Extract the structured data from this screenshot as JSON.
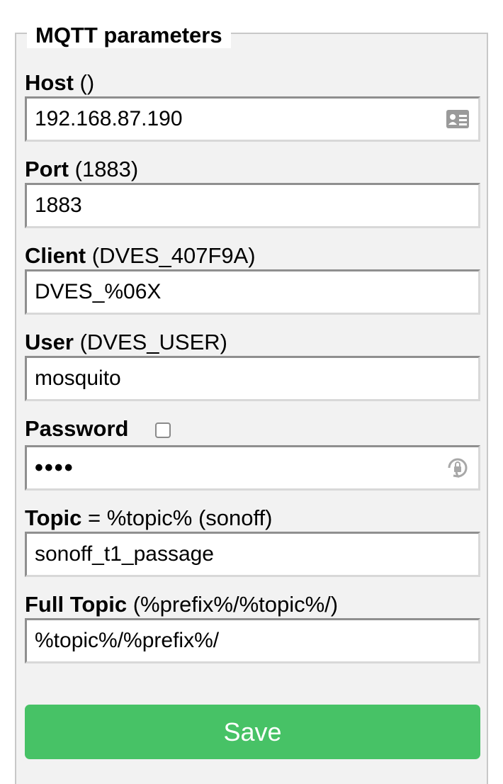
{
  "legend": "MQTT parameters",
  "fields": {
    "host": {
      "label": "Host",
      "hint": "()",
      "value": "192.168.87.190"
    },
    "port": {
      "label": "Port",
      "hint": "(1883)",
      "value": "1883"
    },
    "client": {
      "label": "Client",
      "hint": "(DVES_407F9A)",
      "value": "DVES_%06X"
    },
    "user": {
      "label": "User",
      "hint": "(DVES_USER)",
      "value": "mosquito"
    },
    "password": {
      "label": "Password",
      "value": "••••"
    },
    "topic": {
      "label": "Topic",
      "hint": "= %topic% (sonoff)",
      "value": "sonoff_t1_passage"
    },
    "fulltopic": {
      "label": "Full Topic",
      "hint": "(%prefix%/%topic%/)",
      "value": "%topic%/%prefix%/"
    }
  },
  "icons": {
    "host_field": "contact-card-icon",
    "password_field": "password-key-icon"
  },
  "save_label": "Save",
  "colors": {
    "save_button": "#47c266",
    "fieldset_bg": "#f2f2f2",
    "input_border": "#8f8f8f"
  }
}
